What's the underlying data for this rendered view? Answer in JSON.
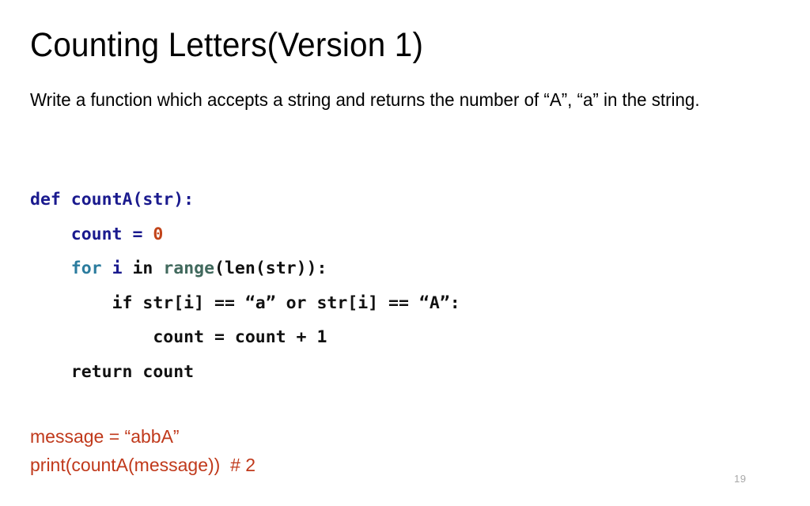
{
  "slide": {
    "title": "Counting Letters(Version 1)",
    "description": "Write a function which accepts a string and returns the number of “A”, “a” in the string.",
    "page_number": "19",
    "background_color": "#ffffff"
  },
  "palette": {
    "black": "#111111",
    "navy": "#1a1a8e",
    "teal_blue": "#2b7c9e",
    "sage_green": "#41695d",
    "orange": "#c2441a",
    "brick_red": "#c0391b",
    "page_number_gray": "#a8a8a8"
  },
  "code": {
    "language": "python",
    "plain_text": "def countA(str):\n    count = 0\n    for i in range(len(str)):\n        if str[i] == “a” or str[i] == “A”:\n            count = count + 1\n    return count",
    "lines": [
      {
        "id": "code-line-def",
        "indent": "",
        "tokens": [
          {
            "text": "def",
            "color": "#1a1a8e"
          },
          {
            "text": " ",
            "color": "#111111"
          },
          {
            "text": "countA(str):",
            "color": "#1a1a8e"
          }
        ]
      },
      {
        "id": "code-line-count-init",
        "indent": "    ",
        "tokens": [
          {
            "text": "count",
            "color": "#1a1a8e"
          },
          {
            "text": " ",
            "color": "#111111"
          },
          {
            "text": "=",
            "color": "#1a1a8e"
          },
          {
            "text": " ",
            "color": "#111111"
          },
          {
            "text": "0",
            "color": "#c2441a"
          }
        ]
      },
      {
        "id": "code-line-for",
        "indent": "    ",
        "tokens": [
          {
            "text": "for",
            "color": "#2b7c9e"
          },
          {
            "text": " ",
            "color": "#111111"
          },
          {
            "text": "i",
            "color": "#1a1a8e"
          },
          {
            "text": " in ",
            "color": "#111111"
          },
          {
            "text": "range",
            "color": "#41695d"
          },
          {
            "text": "(len(str)):",
            "color": "#111111"
          }
        ]
      },
      {
        "id": "code-line-if",
        "indent": "        ",
        "tokens": [
          {
            "text": "if str[i] == “a” or str[i] == “A”:",
            "color": "#111111"
          }
        ]
      },
      {
        "id": "code-line-increment",
        "indent": "            ",
        "tokens": [
          {
            "text": "count = count + 1",
            "color": "#111111"
          }
        ]
      },
      {
        "id": "code-line-return",
        "indent": "    ",
        "tokens": [
          {
            "text": "return count",
            "color": "#111111"
          }
        ]
      }
    ]
  },
  "usage": {
    "lines": [
      {
        "id": "usage-line-message",
        "text": "message = “abbA”",
        "color": "#c0391b"
      },
      {
        "id": "usage-line-print",
        "text": "print(countA(message))  # 2",
        "color": "#c0391b"
      }
    ]
  }
}
